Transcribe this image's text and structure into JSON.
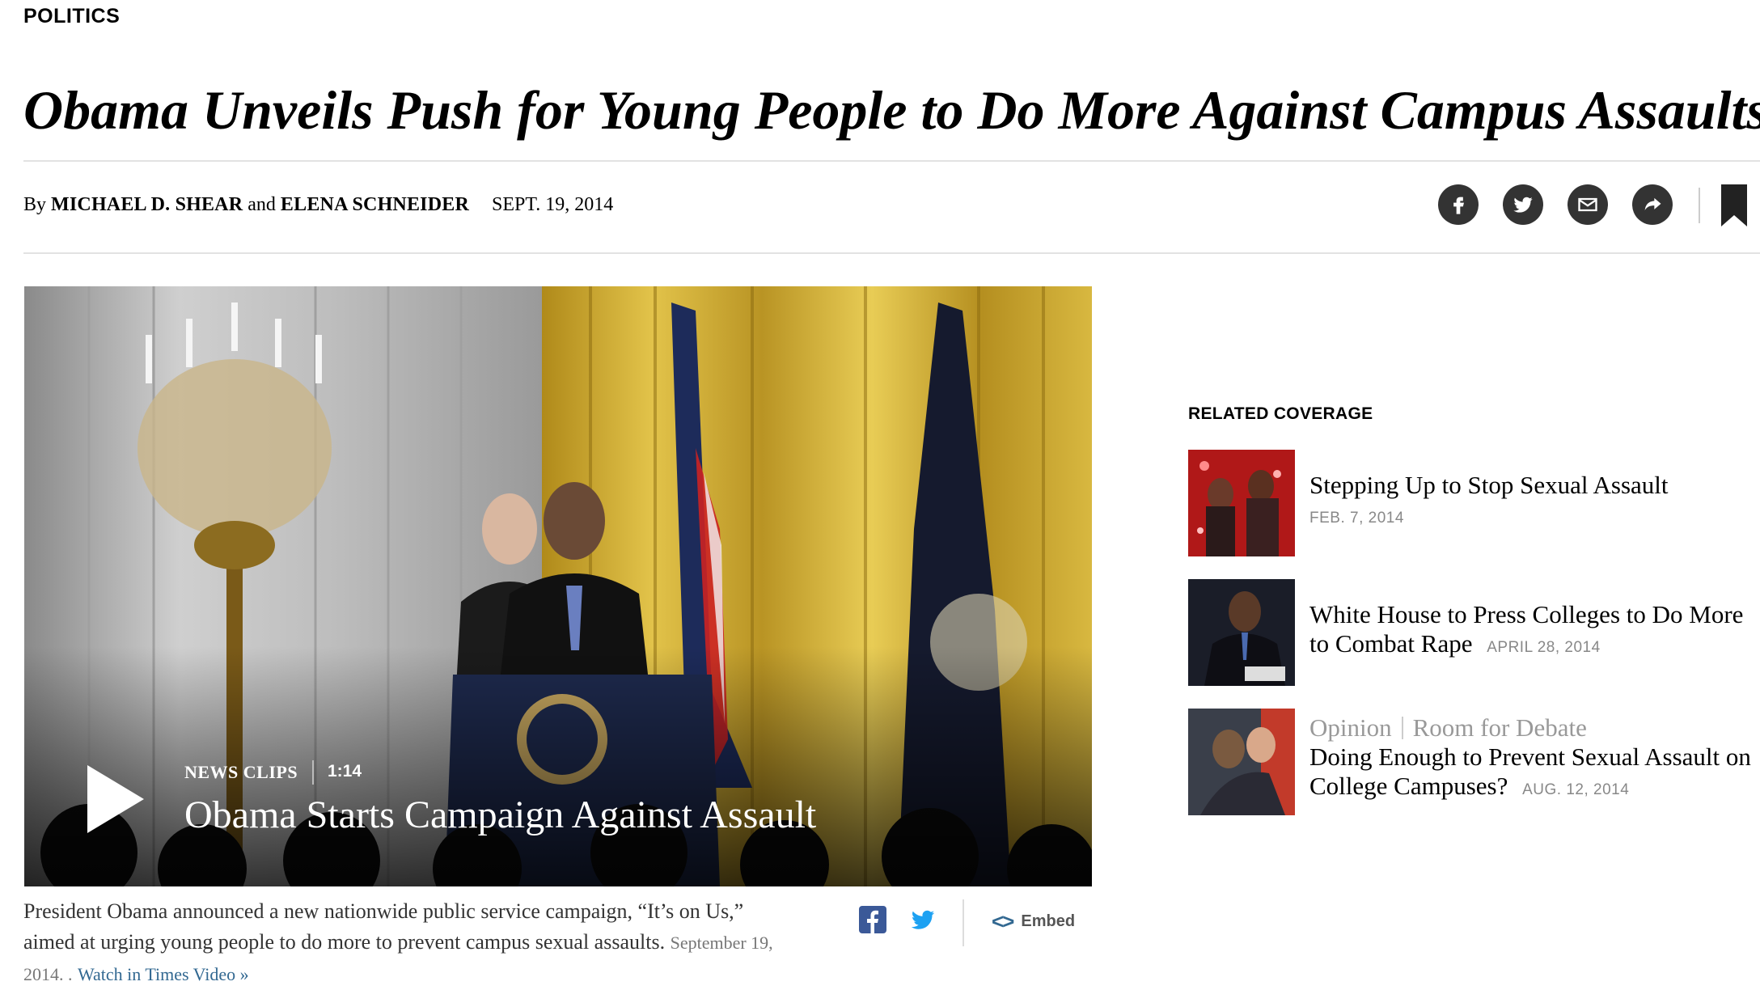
{
  "section": "POLITICS",
  "headline": "Obama Unveils Push for Young People to Do More Against Campus Assaults",
  "byline": {
    "by": "By",
    "author1": "Michael D. Shear",
    "and": "and",
    "author2": "Elena Schneider",
    "date": "Sept. 19, 2014"
  },
  "share_icons": [
    "facebook-icon",
    "twitter-icon",
    "email-icon",
    "share-arrow-icon",
    "bookmark-icon"
  ],
  "video": {
    "kicker": "NEWS CLIPS",
    "duration": "1:14",
    "title": "Obama Starts Campaign Against Assault",
    "caption_main": "President Obama announced a new nationwide public service campaign, “It’s on Us,” aimed at urging young people to do more to prevent campus sexual assaults.",
    "caption_date": "September 19, 2014. .",
    "watch_link": "Watch in Times Video »",
    "embed_label": "Embed",
    "embed_glyph": "<>"
  },
  "related": {
    "heading": "RELATED COVERAGE",
    "items": [
      {
        "title": "Stepping Up to Stop Sexual Assault",
        "date": "Feb. 7, 2014"
      },
      {
        "title": "White House to Press Colleges to Do More to Combat Rape",
        "date": "April 28, 2014"
      },
      {
        "kicker1": "Opinion",
        "kicker2": "Room for Debate",
        "title": "Doing Enough to Prevent Sexual Assault on College Campuses?",
        "date": "Aug. 12, 2014"
      }
    ]
  },
  "colors": {
    "link": "#326891",
    "share_bg": "#333333",
    "facebook": "#3b5998",
    "twitter": "#1da1f2"
  }
}
